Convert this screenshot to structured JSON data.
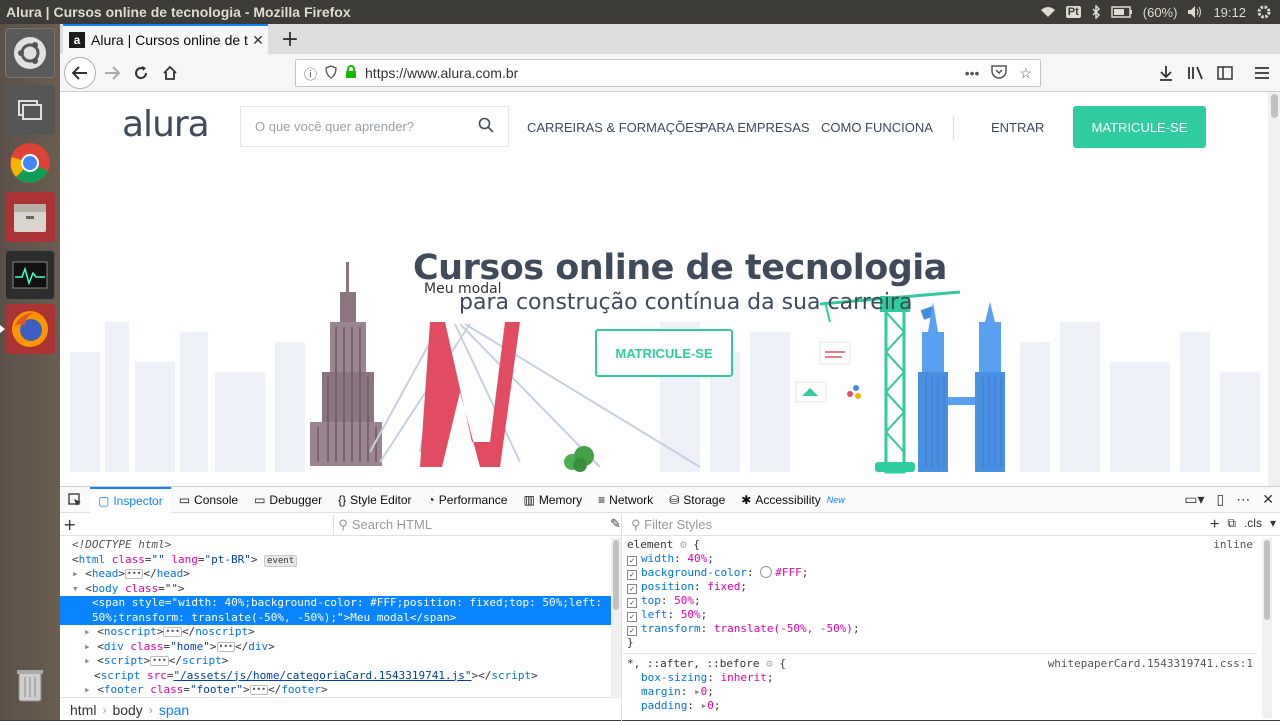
{
  "os": {
    "window_title": "Alura | Cursos online de tecnologia - Mozilla Firefox",
    "pt_badge": "Pt",
    "battery": "(60%)",
    "clock": "19:12"
  },
  "launcher": {
    "items": [
      "Ubuntu Dash",
      "Workspace Switcher",
      "Google Chrome",
      "Files",
      "System Monitor",
      "Firefox",
      "Trash"
    ]
  },
  "browser": {
    "tab_title": "Alura | Cursos online de t",
    "tab_favicon": "a",
    "url": "https://www.alura.com.br",
    "page_actions": "•••"
  },
  "site": {
    "logo": "alura",
    "search_placeholder": "O que você quer aprender?",
    "nav": [
      "CARREIRAS & FORMAÇÕES",
      "PARA EMPRESAS",
      "COMO FUNCIONA",
      "ENTRAR"
    ],
    "cta_top": "MATRICULE-SE",
    "hero_title": "Cursos online de tecnologia",
    "hero_subtitle": "para construção contínua da sua carreira",
    "modal_text": "Meu modal",
    "cta_hero": "MATRICULE-SE",
    "accent": "#2ecc9e"
  },
  "devtools": {
    "tabs": [
      "Inspector",
      "Console",
      "Debugger",
      "Style Editor",
      "Performance",
      "Memory",
      "Network",
      "Storage",
      "Accessibility"
    ],
    "new_badge": "New",
    "search_placeholder": "Search HTML",
    "filter_placeholder": "Filter Styles",
    "cls_label": ".cls",
    "markup": {
      "doctype": "<!DOCTYPE html>",
      "html_tag": "html",
      "html_attr1": "class",
      "html_val1": "\"\"",
      "html_attr2": "lang",
      "html_val2": "\"pt-BR\"",
      "event_badge": "event",
      "head": "head",
      "body_tag": "body",
      "body_attr": "class",
      "body_val": "\"\"",
      "selected_line1": "<span style=\"width: 40%;background-color: #FFF;position: fixed;top: 50%;left:",
      "selected_line2": "50%;transform: translate(-50%, -50%);\">Meu modal</span>",
      "noscript": "noscript",
      "div_tag": "div",
      "div_attr": "class",
      "div_val": "\"home\"",
      "script": "script",
      "script_src_attr": "src",
      "script_src_val": "\"/assets/js/home/categoriaCard.1543319741.js\"",
      "footer_tag": "footer",
      "footer_attr": "class",
      "footer_val": "\"footer\""
    },
    "breadcrumbs": [
      "html",
      "body",
      "span"
    ],
    "rules": {
      "element_selector": "element",
      "inline_label": "inline",
      "decls": [
        {
          "name": "width",
          "value": "40%"
        },
        {
          "name": "background-color",
          "value": "#FFF"
        },
        {
          "name": "position",
          "value": "fixed"
        },
        {
          "name": "top",
          "value": "50%"
        },
        {
          "name": "left",
          "value": "50%"
        },
        {
          "name": "transform",
          "value": "translate(-50%, -50%)"
        }
      ],
      "universal_selector": "*, ::after, ::before",
      "universal_source": "whitepaperCard.1543319741.css:1",
      "universal_decls": [
        {
          "name": "box-sizing",
          "value": "inherit"
        },
        {
          "name": "margin",
          "value": "0"
        },
        {
          "name": "padding",
          "value": "0"
        }
      ]
    }
  }
}
